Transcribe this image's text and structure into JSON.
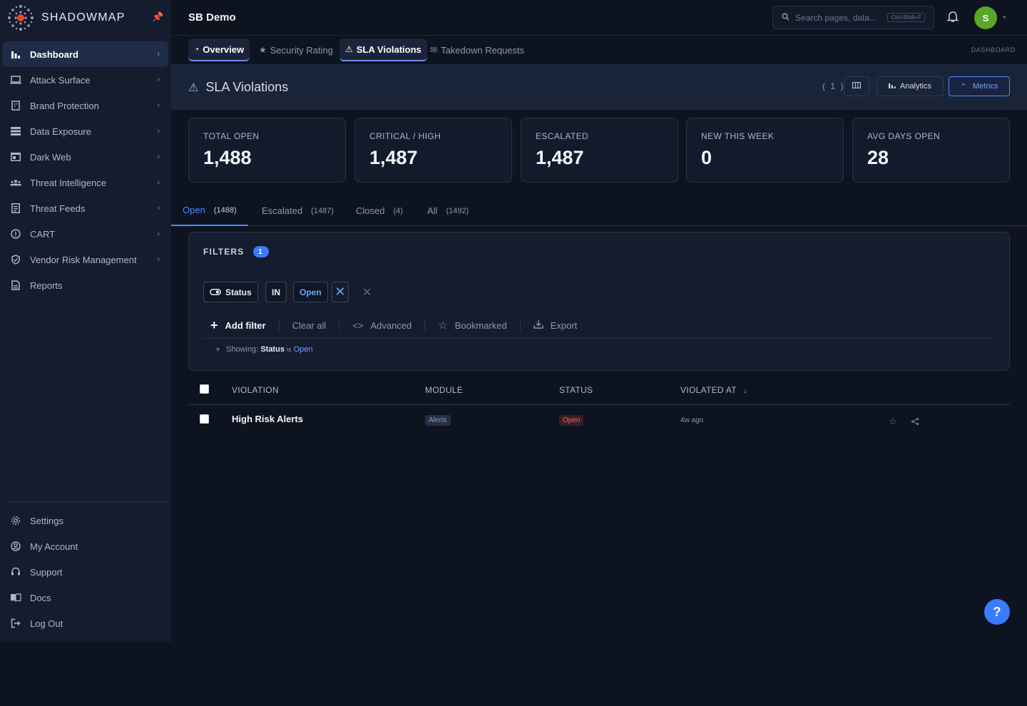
{
  "brand": {
    "name": "SHADOWMAP",
    "logo_icon": "globe-dots-icon",
    "pin_icon": "pin-icon"
  },
  "sidebar": {
    "items": [
      {
        "label": "Dashboard",
        "icon": "bar-chart-icon",
        "active": true
      },
      {
        "label": "Attack Surface",
        "icon": "laptop-icon"
      },
      {
        "label": "Brand Protection",
        "icon": "building-icon"
      },
      {
        "label": "Data Exposure",
        "icon": "database-icon"
      },
      {
        "label": "Dark Web",
        "icon": "web-icon"
      },
      {
        "label": "Threat Intelligence",
        "icon": "group-icon"
      },
      {
        "label": "Threat Feeds",
        "icon": "feed-icon"
      },
      {
        "label": "CART",
        "icon": "cart-icon"
      },
      {
        "label": "Vendor Risk Management",
        "icon": "shield-icon"
      },
      {
        "label": "Reports",
        "icon": "report-icon"
      }
    ],
    "bottom": [
      {
        "label": "Settings",
        "icon": "gear-icon"
      },
      {
        "label": "My Account",
        "icon": "user-icon"
      },
      {
        "label": "Support",
        "icon": "support-icon"
      },
      {
        "label": "Docs",
        "icon": "book-icon"
      },
      {
        "label": "Log Out",
        "icon": "logout-icon"
      }
    ]
  },
  "topbar": {
    "org": "SB Demo",
    "search_placeholder": "Search pages, data...",
    "shortcut": "Ctrl+Shift+F",
    "avatar_initial": "S",
    "avatar_color": "#5aa626"
  },
  "subtabs": [
    {
      "label": "Overview",
      "active": true
    },
    {
      "label": "Security Rating",
      "active": false
    },
    {
      "label": "SLA Violations",
      "active": true
    },
    {
      "label": "Takedown Requests",
      "active": false
    }
  ],
  "crumb": "DASHBOARD",
  "header": {
    "title": "SLA Violations",
    "count": "( 1 )",
    "analytics_label": "Analytics",
    "metrics_label": "Metrics"
  },
  "stats": [
    {
      "label": "TOTAL OPEN",
      "value": "1,488"
    },
    {
      "label": "CRITICAL / HIGH",
      "value": "1,487"
    },
    {
      "label": "ESCALATED",
      "value": "1,487"
    },
    {
      "label": "NEW THIS WEEK",
      "value": "0"
    },
    {
      "label": "AVG DAYS OPEN",
      "value": "28"
    }
  ],
  "status_tabs": [
    {
      "label": "Open",
      "count": "(1488)",
      "active": true
    },
    {
      "label": "Escalated",
      "count": "(1487)"
    },
    {
      "label": "Closed",
      "count": "(4)"
    },
    {
      "label": "All",
      "count": "(1492)"
    }
  ],
  "filters": {
    "title": "FILTERS",
    "badge": "1",
    "chip_field": "Status",
    "chip_op": "IN",
    "chip_value": "Open",
    "add_filter": "Add filter",
    "clear_all": "Clear all",
    "advanced": "Advanced",
    "bookmarked": "Bookmarked",
    "export": "Export",
    "showing_prefix": "Showing:",
    "showing_field": "Status",
    "showing_op": "is",
    "showing_value": "Open"
  },
  "table": {
    "columns": [
      "VIOLATION",
      "MODULE",
      "STATUS",
      "VIOLATED AT"
    ],
    "rows": [
      {
        "violation": "High Risk Alerts",
        "module": "Alerts",
        "status": "Open",
        "violated_at": "4w ago"
      }
    ]
  },
  "help_label": "?",
  "colors": {
    "accent": "#4d8bff",
    "open_status": "#ff5a5a",
    "sidebar_bg": "#141c2e"
  }
}
